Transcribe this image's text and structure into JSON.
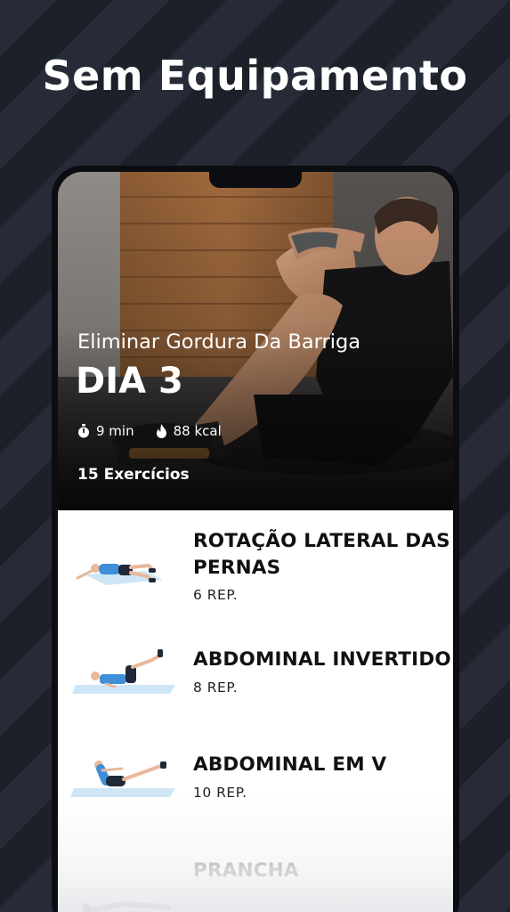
{
  "promo": {
    "title": "Sem Equipamento"
  },
  "workout": {
    "subtitle": "Eliminar Gordura Da Barriga",
    "day": "DIA 3",
    "duration": "9 min",
    "calories": "88 kcal",
    "exercise_count": "15 Exercícios",
    "icons": {
      "duration": "stopwatch-icon",
      "calories": "flame-icon"
    }
  },
  "exercises": [
    {
      "name": "ROTAÇÃO LATERAL DAS PERNAS",
      "reps": "6 REP."
    },
    {
      "name": "ABDOMINAL INVERTIDO",
      "reps": "8 REP."
    },
    {
      "name": "ABDOMINAL EM V",
      "reps": "10 REP."
    },
    {
      "name": "PRANCHA",
      "reps": ""
    }
  ],
  "colors": {
    "background": "#1f2430",
    "accent_mat": "#cfe6f7",
    "shirt": "#3f8fd8"
  }
}
